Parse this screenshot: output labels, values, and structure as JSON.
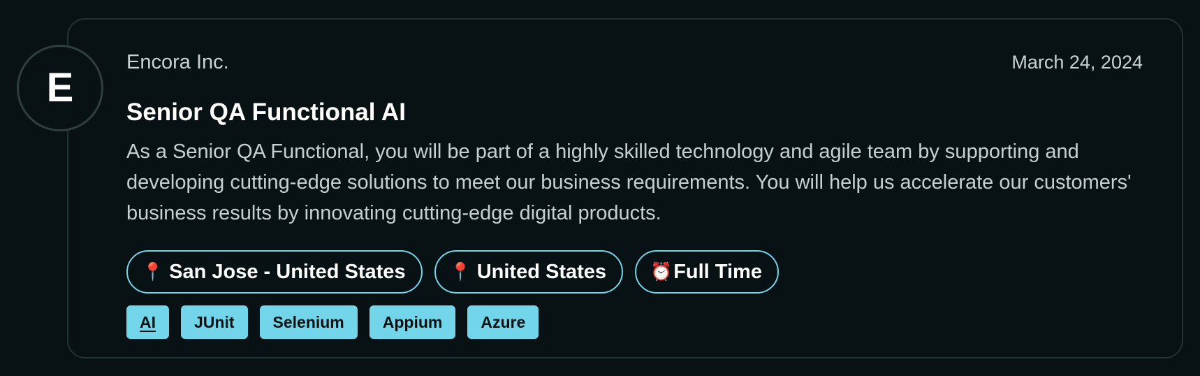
{
  "job": {
    "company_initial": "E",
    "company": "Encora Inc.",
    "date": "March 24, 2024",
    "title": "Senior QA Functional AI",
    "description": "As a Senior QA Functional, you will be part of a highly skilled technology and agile team by supporting and developing cutting-edge solutions to meet our business requirements. You will help us accelerate our customers' business results by innovating cutting-edge digital products.",
    "locations": [
      {
        "icon": "pin-icon",
        "label": "San Jose - United States"
      },
      {
        "icon": "pin-icon",
        "label": "United States"
      },
      {
        "icon": "alarm-clock-icon",
        "label": "Full Time"
      }
    ],
    "tags": [
      "AI",
      "JUnit",
      "Selenium",
      "Appium",
      "Azure"
    ]
  },
  "colors": {
    "background": "#081214",
    "card_border": "#233233",
    "accent": "#76D4E8",
    "tag_background": "#72D5EA",
    "title_text": "#FFFFFF",
    "body_text": "#C6CFD1"
  },
  "icons": {
    "avatar": "company-initial-avatar",
    "location": "pin-icon",
    "employment_type": "alarm-clock-icon"
  }
}
